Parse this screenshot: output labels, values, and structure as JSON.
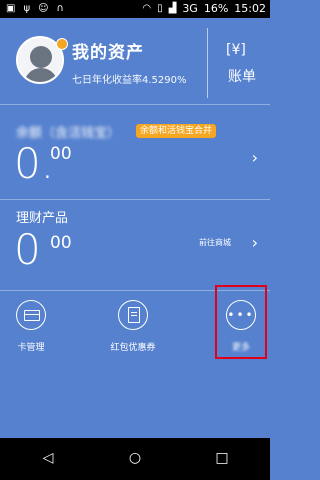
{
  "status_bar": {
    "left_icons": [
      "notification-icon",
      "usb-icon",
      "android-icon",
      "headphones-icon"
    ],
    "network_label": "3G",
    "battery_percent": "16%",
    "time": "15:02"
  },
  "header": {
    "title": "我的资产",
    "subtitle": "七日年化收益率4.5290%",
    "bill_icon": "[¥]",
    "bill_label": "账单"
  },
  "yuebao": {
    "label": "余额（含活钱宝）",
    "badge": "余额和活钱宝合并",
    "amount_int": "0.",
    "amount_dec": "00"
  },
  "wealth": {
    "label": "理财产品",
    "amount_int": "0",
    "amount_dec": "00",
    "link": "前往商城"
  },
  "tools": {
    "card": {
      "label": "卡管理"
    },
    "coupon": {
      "label": "红包优惠券"
    },
    "more": {
      "label": "更多"
    }
  },
  "colors": {
    "background": "#5581cf",
    "accent": "#f5a623",
    "highlight": "#e3001a"
  }
}
